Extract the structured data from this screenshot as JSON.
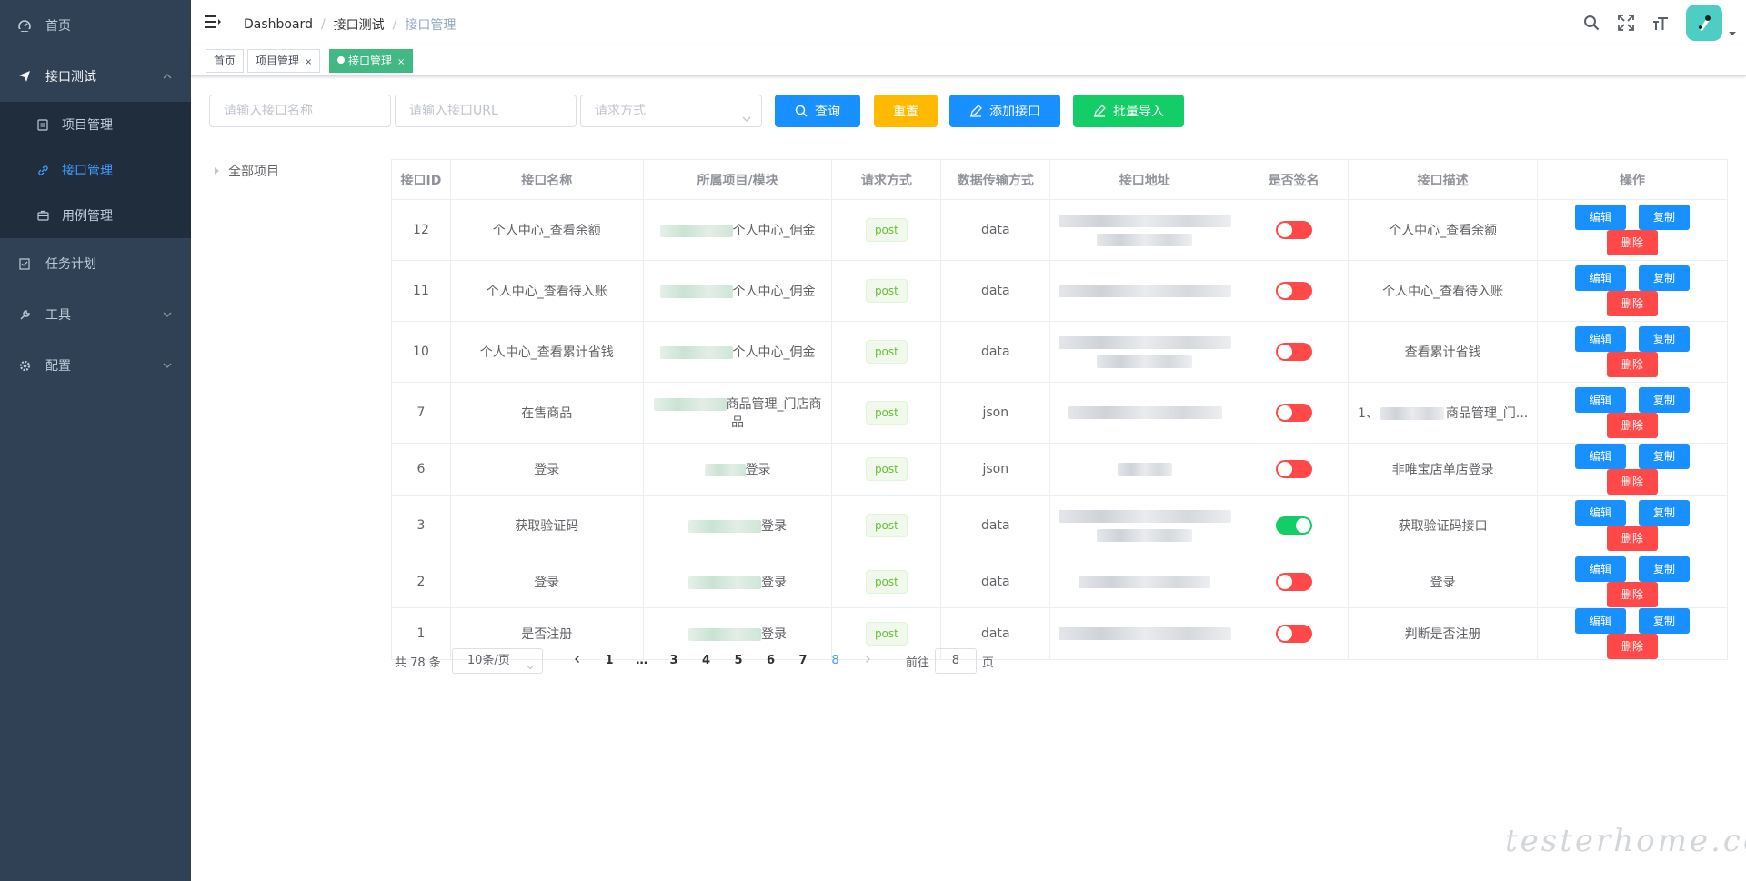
{
  "sidebar": {
    "items": [
      {
        "label": "首页",
        "icon": "dashboard-icon"
      },
      {
        "label": "接口测试",
        "icon": "send-icon"
      },
      {
        "label": "任务计划",
        "icon": "task-icon"
      },
      {
        "label": "工具",
        "icon": "tool-icon"
      },
      {
        "label": "配置",
        "icon": "gear-icon"
      }
    ],
    "sub_items": [
      {
        "label": "项目管理",
        "icon": "project-icon"
      },
      {
        "label": "接口管理",
        "icon": "link-icon"
      },
      {
        "label": "用例管理",
        "icon": "case-icon"
      }
    ]
  },
  "header": {
    "breadcrumb": [
      "Dashboard",
      "接口测试",
      "接口管理"
    ]
  },
  "tags": [
    {
      "label": "首页"
    },
    {
      "label": "项目管理",
      "close": "×"
    },
    {
      "label": "接口管理",
      "close": "×"
    }
  ],
  "filters": {
    "name_placeholder": "请输入接口名称",
    "url_placeholder": "请输入接口URL",
    "method_placeholder": "请求方式",
    "query_label": "查询",
    "reset_label": "重置",
    "add_label": "添加接口",
    "import_label": "批量导入"
  },
  "tree": {
    "root_label": "全部项目"
  },
  "table": {
    "headers": [
      "接口ID",
      "接口名称",
      "所属项目/模块",
      "请求方式",
      "数据传输方式",
      "接口地址",
      "是否签名",
      "接口描述",
      "操作"
    ],
    "rows": [
      {
        "id": "12",
        "name": "个人中心_查看余额",
        "module_suffix": "个人中心_佣金",
        "method": "post",
        "transfer": "data",
        "signed": false,
        "desc": "个人中心_查看余额"
      },
      {
        "id": "11",
        "name": "个人中心_查看待入账",
        "module_suffix": "个人中心_佣金",
        "method": "post",
        "transfer": "data",
        "signed": false,
        "desc": "个人中心_查看待入账"
      },
      {
        "id": "10",
        "name": "个人中心_查看累计省钱",
        "module_suffix": "个人中心_佣金",
        "method": "post",
        "transfer": "data",
        "signed": false,
        "desc": "查看累计省钱"
      },
      {
        "id": "7",
        "name": "在售商品",
        "module_suffix": "商品管理_门店商品",
        "method": "post",
        "transfer": "json",
        "signed": false,
        "desc": "1、 商品管理_门..."
      },
      {
        "id": "6",
        "name": "登录",
        "module_suffix": "登录",
        "method": "post",
        "transfer": "json",
        "signed": false,
        "desc": "非唯宝店单店登录"
      },
      {
        "id": "3",
        "name": "获取验证码",
        "module_suffix": "登录",
        "method": "post",
        "transfer": "data",
        "signed": true,
        "desc": "获取验证码接口"
      },
      {
        "id": "2",
        "name": "登录",
        "module_suffix": "登录",
        "method": "post",
        "transfer": "data",
        "signed": false,
        "desc": "登录"
      },
      {
        "id": "1",
        "name": "是否注册",
        "module_suffix": "登录",
        "method": "post",
        "transfer": "data",
        "signed": false,
        "desc": "判断是否注册"
      }
    ],
    "actions": {
      "edit": "编辑",
      "copy": "复制",
      "delete": "删除"
    }
  },
  "pagination": {
    "total_text": "共 78 条",
    "page_size": "10条/页",
    "pages": [
      "1",
      "…",
      "3",
      "4",
      "5",
      "6",
      "7",
      "8"
    ],
    "current_page": "8",
    "goto_prefix": "前往",
    "goto_value": "8",
    "goto_suffix": "页"
  },
  "watermark": "testerhome.com",
  "colors": {
    "sidebar_bg": "#304156",
    "submenu_bg": "#1f2d3d",
    "primary": "#1890ff",
    "warning": "#ffba00",
    "success": "#13ce66",
    "danger": "#ff4949",
    "tag_active": "#42b983",
    "switch_off": "#ff4949",
    "switch_on": "#13ce66"
  }
}
